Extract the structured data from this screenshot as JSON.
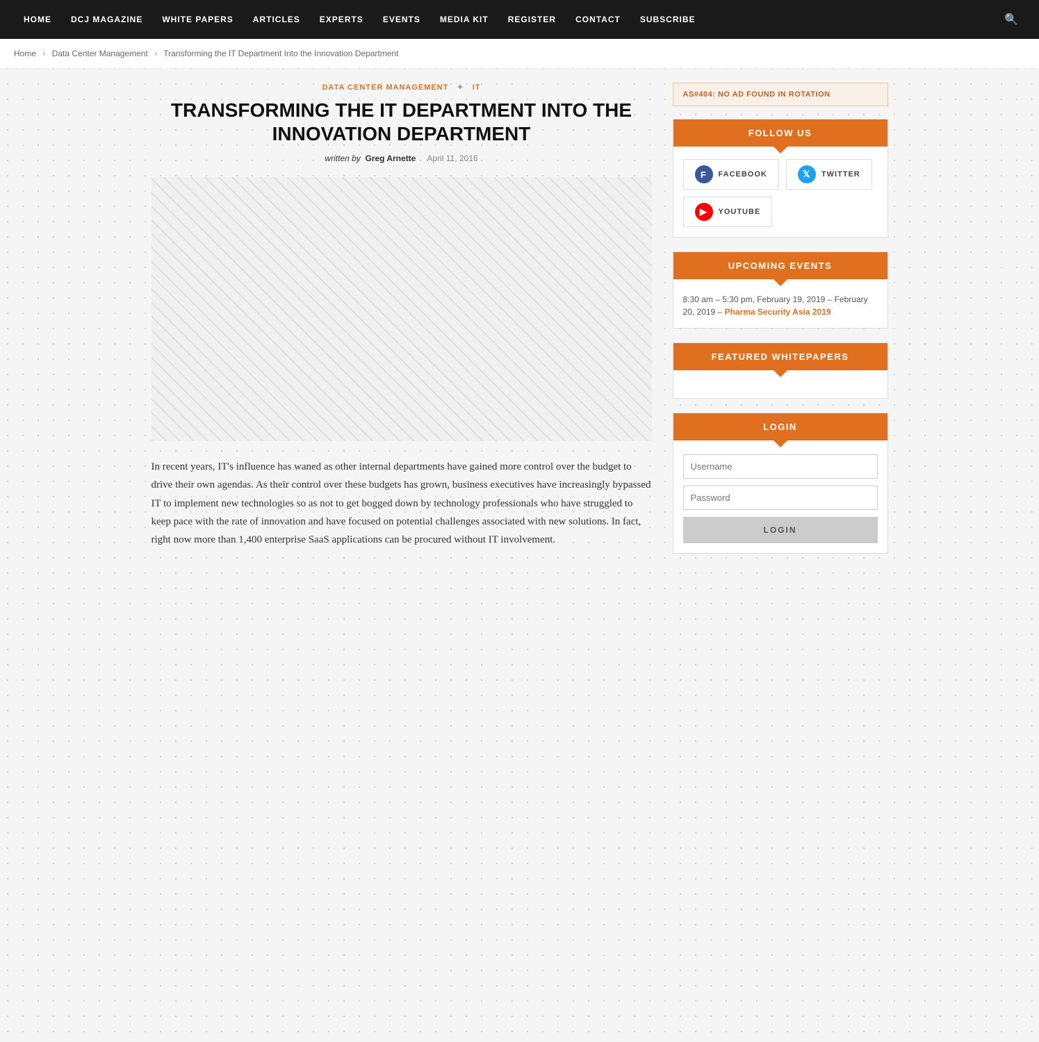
{
  "nav": {
    "items": [
      {
        "label": "HOME",
        "href": "#"
      },
      {
        "label": "DCJ MAGAZINE",
        "href": "#"
      },
      {
        "label": "WHITE PAPERS",
        "href": "#"
      },
      {
        "label": "ARTICLES",
        "href": "#"
      },
      {
        "label": "EXPERTS",
        "href": "#"
      },
      {
        "label": "EVENTS",
        "href": "#"
      },
      {
        "label": "MEDIA KIT",
        "href": "#"
      },
      {
        "label": "REGISTER",
        "href": "#"
      },
      {
        "label": "CONTACT",
        "href": "#"
      },
      {
        "label": "SUBSCRIBE",
        "href": "#"
      }
    ]
  },
  "breadcrumb": {
    "home": "Home",
    "section": "Data Center Management",
    "current": "Transforming the IT Department Into the Innovation Department"
  },
  "article": {
    "category1": "DATA CENTER MANAGEMENT",
    "category2": "IT",
    "title": "TRANSFORMING THE IT DEPARTMENT INTO THE INNOVATION DEPARTMENT",
    "written_by": "written by",
    "author": "Greg Arnette",
    "date": "April 11, 2016",
    "body_text": "In recent years, IT's influence has waned as other internal departments have gained more control over the budget to drive their own agendas. As their control over these budgets has grown, business executives have increasingly bypassed IT to implement new technologies so as not to get bogged down by technology professionals who have struggled to keep pace with the rate of innovation and have focused on potential challenges associated with new solutions. In fact, right now more than 1,400 enterprise SaaS applications can be procured without IT involvement."
  },
  "sidebar": {
    "ad_notice": "AS#404: NO AD FOUND IN ROTATION",
    "follow_us": {
      "header": "FOLLOW US",
      "facebook": "FACEBOOK",
      "twitter": "TWITTER",
      "youtube": "YOUTUBE"
    },
    "upcoming_events": {
      "header": "UPCOMING EVENTS",
      "event_time": "8:30 am – 5:30 pm, February 19, 2019 – February 20, 2019 –",
      "event_link": "Pharma Security Asia 2019"
    },
    "featured_whitepapers": {
      "header": "FEATURED WHITEPAPERS"
    },
    "login": {
      "header": "LOGIN",
      "username_placeholder": "Username",
      "password_placeholder": "Password",
      "button_label": "LOGIN"
    }
  }
}
